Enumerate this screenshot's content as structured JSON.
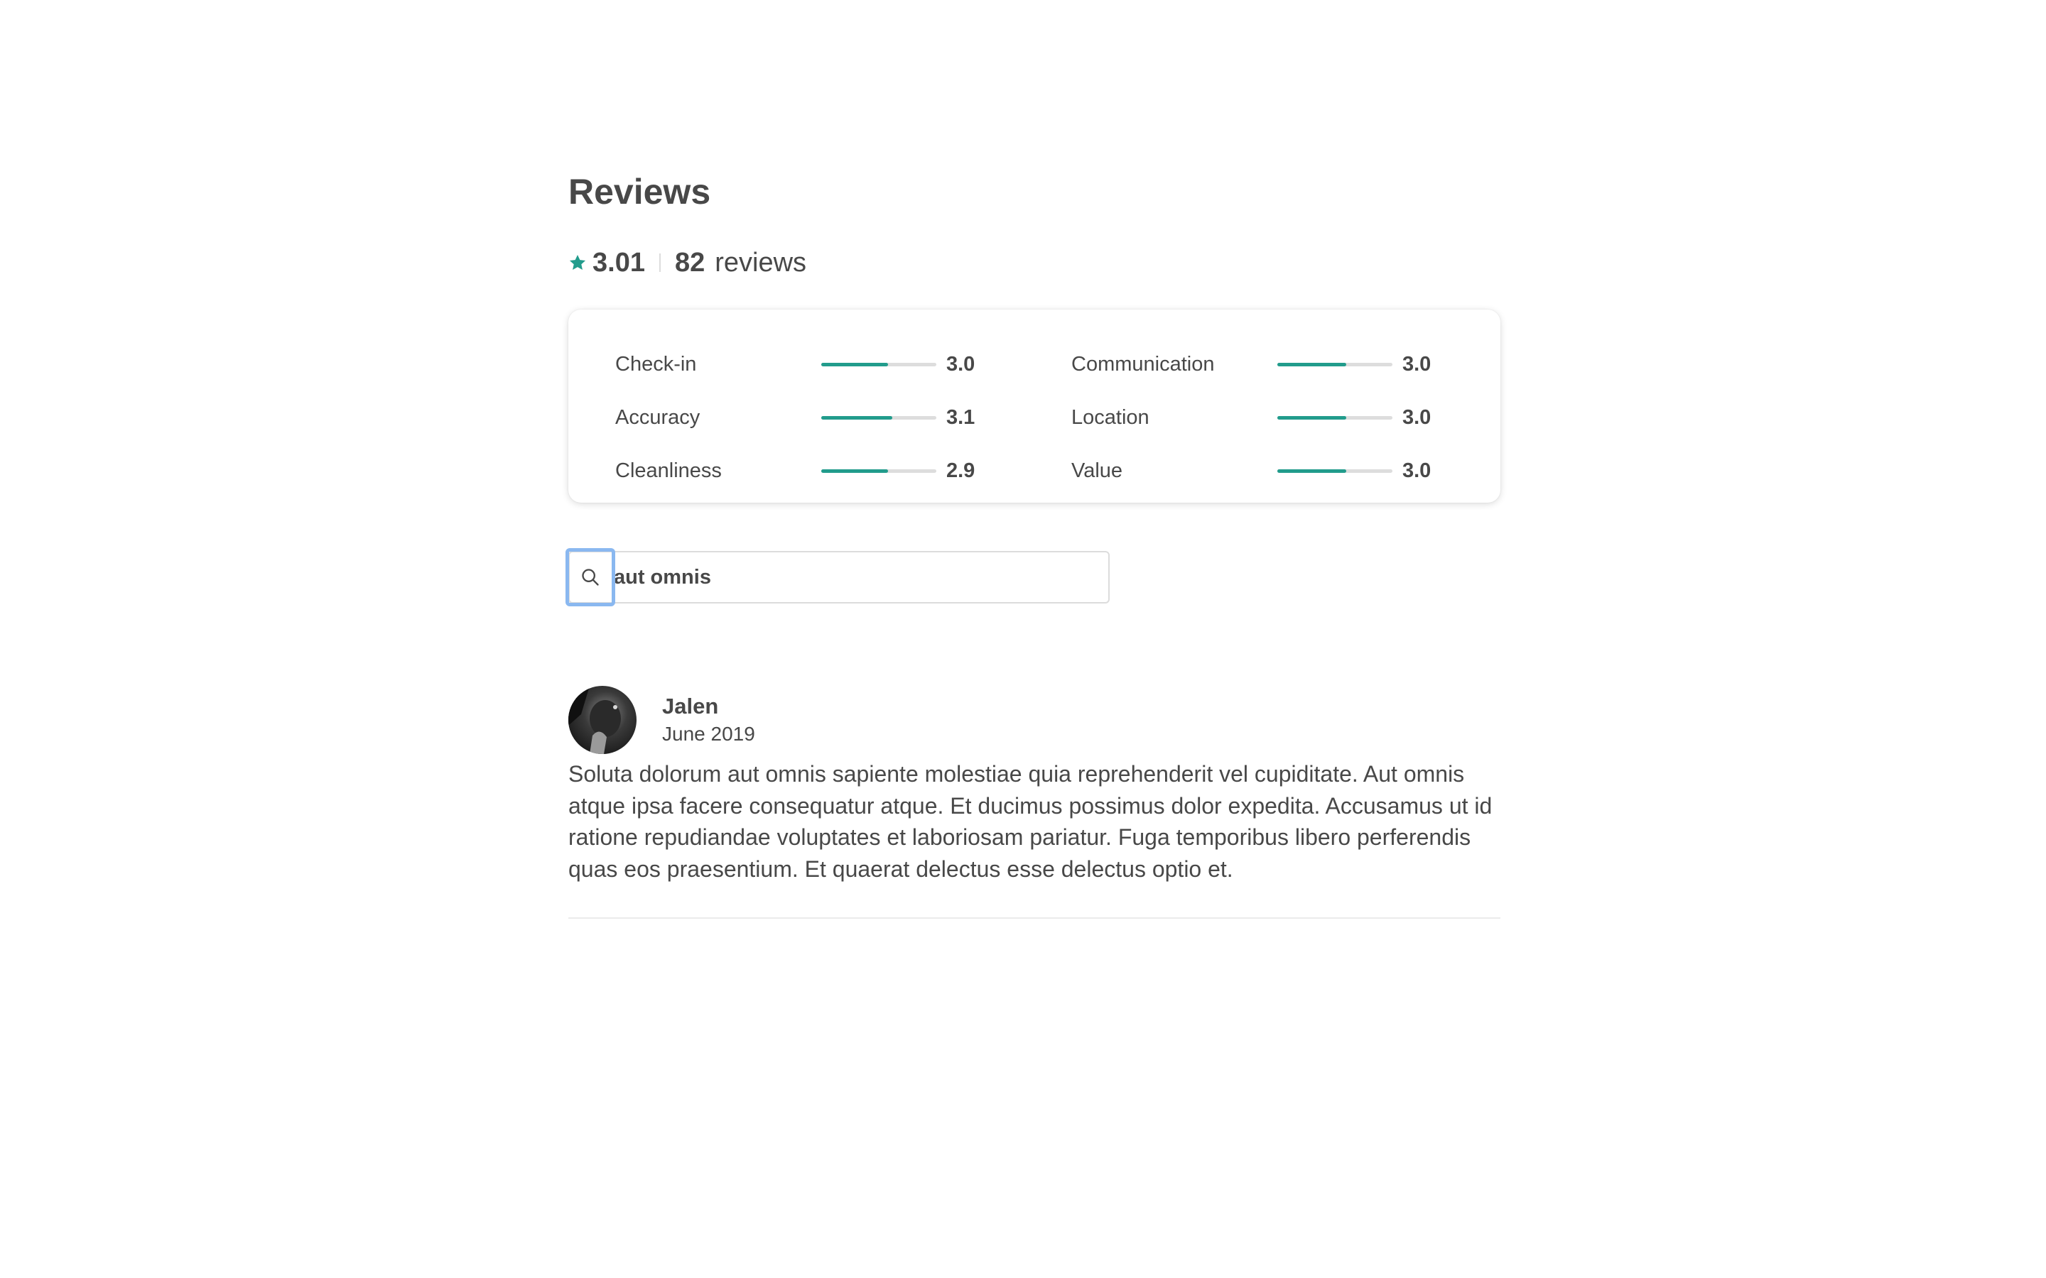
{
  "header": {
    "title": "Reviews"
  },
  "summary": {
    "overall_rating": "3.01",
    "review_count": "82",
    "review_count_label": "reviews",
    "star_icon": "star-icon",
    "accent_color": "#229c8c"
  },
  "ratings": [
    {
      "label": "Check-in",
      "value": "3.0",
      "fraction": 0.58
    },
    {
      "label": "Communication",
      "value": "3.0",
      "fraction": 0.6
    },
    {
      "label": "Accuracy",
      "value": "3.1",
      "fraction": 0.62
    },
    {
      "label": "Location",
      "value": "3.0",
      "fraction": 0.6
    },
    {
      "label": "Cleanliness",
      "value": "2.9",
      "fraction": 0.58
    },
    {
      "label": "Value",
      "value": "3.0",
      "fraction": 0.6
    }
  ],
  "search": {
    "value": "aut omnis",
    "icon": "search-icon"
  },
  "reviews": [
    {
      "name": "Jalen",
      "date": "June 2019",
      "text": "Soluta dolorum aut omnis sapiente molestiae quia reprehenderit vel cupiditate. Aut omnis atque ipsa facere consequatur atque. Et ducimus possimus dolor expedita. Accusamus ut id ratione repudiandae voluptates et laboriosam pariatur. Fuga temporibus libero perferendis quas eos praesentium. Et quaerat delectus esse delectus optio et."
    }
  ]
}
